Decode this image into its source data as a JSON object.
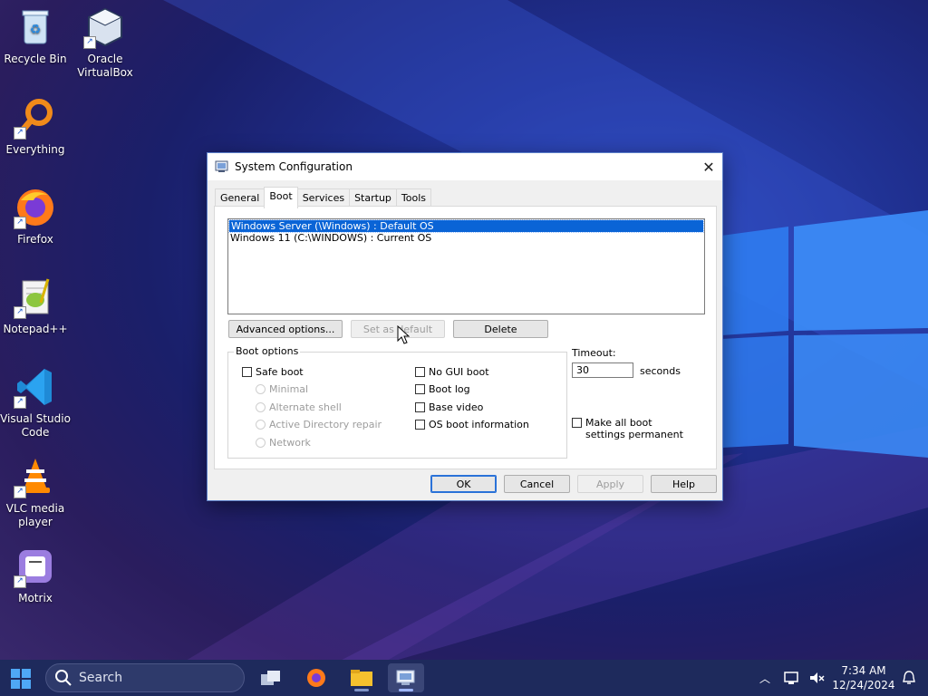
{
  "desktop": {
    "icons": [
      {
        "label": "Recycle Bin"
      },
      {
        "label": "Oracle VirtualBox"
      },
      {
        "label": "Everything"
      },
      {
        "label": "Firefox"
      },
      {
        "label": "Notepad++"
      },
      {
        "label": "Visual Studio Code"
      },
      {
        "label": "VLC media player"
      },
      {
        "label": "Motrix"
      }
    ]
  },
  "dialog": {
    "title": "System Configuration",
    "tabs": [
      "General",
      "Boot",
      "Services",
      "Startup",
      "Tools"
    ],
    "active_tab": "Boot",
    "os_list": [
      "Windows Server (\\Windows) : Default OS",
      "Windows 11 (C:\\WINDOWS) : Current OS"
    ],
    "buttons": {
      "advanced": "Advanced options...",
      "set_default": "Set as default",
      "delete": "Delete"
    },
    "boot_options": {
      "legend": "Boot options",
      "safe_boot": "Safe boot",
      "minimal": "Minimal",
      "alternate_shell": "Alternate shell",
      "ad_repair": "Active Directory repair",
      "network": "Network",
      "no_gui_boot": "No GUI boot",
      "boot_log": "Boot log",
      "base_video": "Base video",
      "os_boot_info": "OS boot information"
    },
    "timeout": {
      "label": "Timeout:",
      "value": "30",
      "unit": "seconds"
    },
    "make_permanent": "Make all boot settings permanent",
    "footer": {
      "ok": "OK",
      "cancel": "Cancel",
      "apply": "Apply",
      "help": "Help"
    }
  },
  "taskbar": {
    "search_label": "Search",
    "time": "7:34 AM",
    "date": "12/24/2024"
  }
}
